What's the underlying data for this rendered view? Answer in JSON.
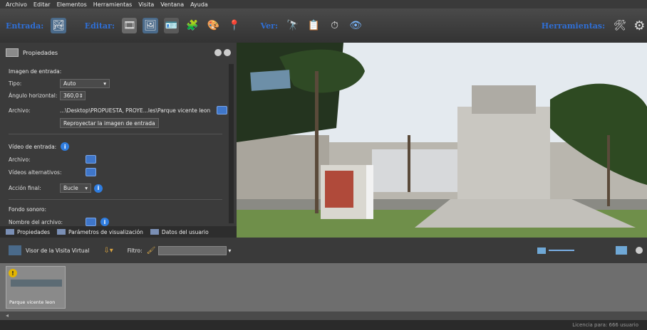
{
  "menu": [
    "Archivo",
    "Editar",
    "Elementos",
    "Herramientas",
    "Visita",
    "Ventana",
    "Ayuda"
  ],
  "toolbar": {
    "entrada_label": "Entrada:",
    "editar_label": "Editar:",
    "ver_label": "Ver:",
    "herramientas_label": "Herramientas:"
  },
  "panel": {
    "title": "Propiedades",
    "image_section": "Imagen de entrada:",
    "tipo_label": "Tipo:",
    "tipo_value": "Auto",
    "angle_label": "Ángulo horizontal:",
    "angle_value": "360,0",
    "archivo_label": "Archivo:",
    "archivo_value": "...\\Desktop\\PROPUESTA, PROYE...les\\Parque vicente leon.jpg",
    "reproject_button": "Reproyectar la imagen de entrada",
    "video_section": "Vídeo de entrada:",
    "video_archivo_label": "Archivo:",
    "videos_alt_label": "Vídeos alternativos:",
    "accion_label": "Acción final:",
    "accion_value": "Bucle",
    "sound_section": "Fondo sonoro:",
    "sound_file_label": "Nombre del archivo:"
  },
  "tabs": [
    "Propiedades",
    "Parámetros de visualización",
    "Datos del usuario"
  ],
  "secondary": {
    "visor_label": "Visor de la Visita Virtual",
    "filtro_label": "Filtro:"
  },
  "strip": {
    "item_label": "Parque vicente leon"
  },
  "status": {
    "text": "Licencia para: 666 usuario"
  },
  "colors": {
    "accent_blue": "#2f6fd6",
    "panel_bg": "#3b3b3b",
    "strip_bg": "#6e6e6e"
  }
}
